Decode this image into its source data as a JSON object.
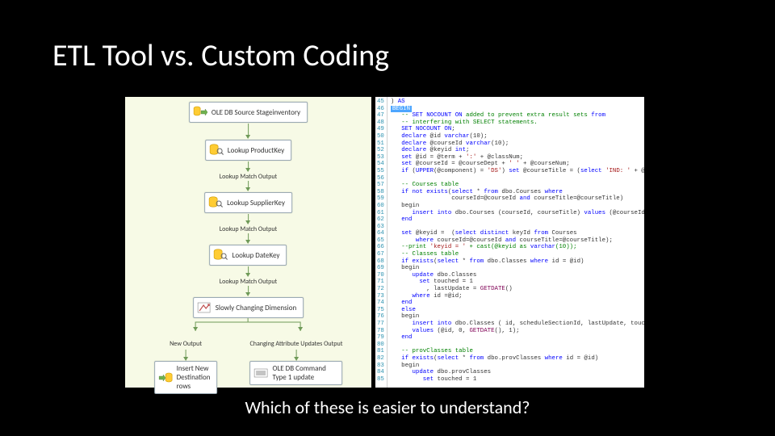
{
  "title": "ETL Tool vs. Custom Coding",
  "caption": "Which of these is easier to understand?",
  "etl": {
    "nodes": {
      "src": "OLE DB Source Stageinventory",
      "lookup1": "Lookup ProductKey",
      "lookup2": "Lookup SupplierKey",
      "lookup3": "Lookup DateKey",
      "scd": "Slowly Changing Dimension",
      "dest": "Insert New Destination rows",
      "cmd": "OLE DB Command Type 1 update"
    },
    "arrows": {
      "match": "Lookup Match Output",
      "newOut": "New Output",
      "chgOut": "Changing Attribute Updates Output"
    }
  },
  "code": {
    "startLine": 45,
    "lines": [
      ") AS",
      "BEGIN",
      "   -- SET NOCOUNT ON added to prevent extra result sets from",
      "   -- interfering with SELECT statements.",
      "   SET NOCOUNT ON;",
      "   declare @id varchar(10);",
      "   declare @courseId varchar(10);",
      "   declare @keyid int;",
      "   set @id = @term + ':' + @classNum;",
      "   set @courseId = @courseDept + ' ' + @courseNum;",
      "   if (UPPER(@component) = 'DS') set @courseTitle = (select 'IND: ' + @courseTitle);",
      "",
      "   -- Courses table",
      "   if not exists(select * from dbo.Courses where",
      "                 courseId=@courseId and courseTitle=@courseTitle)",
      "   begin",
      "      insert into dbo.Courses (courseId, courseTitle) values (@courseId, @courseTitle);",
      "   end",
      "",
      "   set @keyid =  (select distinct keyId from Courses",
      "       where courseId=@courseId and courseTitle=@courseTitle);",
      "   --print 'keyid = ' + cast(@keyid as varchar(10));",
      "   -- Classes table",
      "   if exists(select * from dbo.Classes where id = @id)",
      "   begin",
      "      update dbo.Classes",
      "        set touched = 1",
      "          , lastUpdate = GETDATE()",
      "      where id =@id;",
      "   end",
      "   else",
      "   begin",
      "      insert into dbo.Classes ( id, scheduleSectionId, lastUpdate, touched)",
      "      values (@id, 0, GETDATE(), 1);",
      "   end",
      "",
      "   -- provClasses table",
      "   if exists(select * from dbo.provClasses where id = @id)",
      "   begin",
      "      update dbo.provClasses",
      "         set touched = 1"
    ]
  }
}
